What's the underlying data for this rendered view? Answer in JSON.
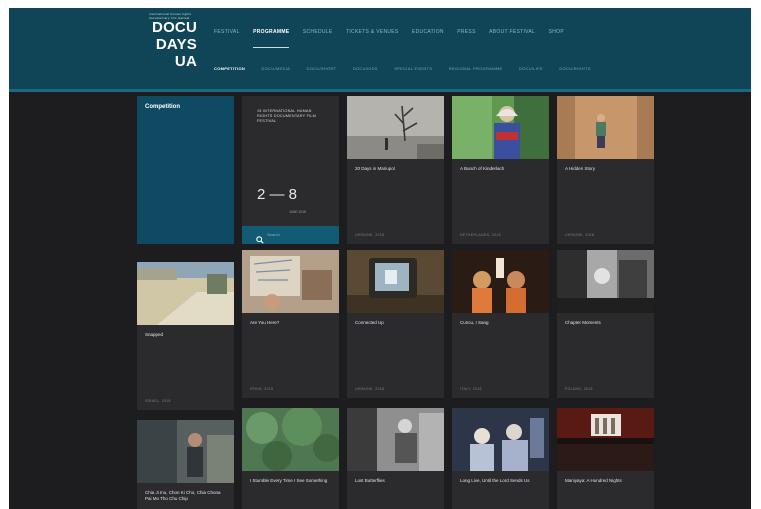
{
  "logo": {
    "tagline": "international human rights documentary film festival",
    "lines": [
      "DOCU",
      "DAYS",
      "UA"
    ]
  },
  "main_nav": [
    "Festival",
    "Programme",
    "Schedule",
    "Tickets & Venues",
    "Education",
    "Press",
    "About festival",
    "Shop"
  ],
  "main_nav_active": 1,
  "sub_nav": [
    "Competition",
    "DOCU/MEDIA",
    "DOCU/SHORT",
    "DOCU/KIDS",
    "SPECIAL EVENTS",
    "REGIONAL PROGRAMME",
    "DOCU/LIFE",
    "DOCU/RIGHTS"
  ],
  "sub_nav_active": 0,
  "competition": {
    "heading": "Competition"
  },
  "festival": {
    "text": "15 International Human Rights Documentary Film Festival",
    "dates": "2 — 8",
    "dates_sub": "June 2018",
    "search_placeholder": "Search"
  },
  "films": [
    {
      "title": "20 Days in Mariupol",
      "meta": "Ukraine, 2018"
    },
    {
      "title": "A Bunch of Kinderlach",
      "meta": "Netherlands, 2018"
    },
    {
      "title": "A Hidden Story",
      "meta": "Ukraine, 2018"
    },
    {
      "title": "Snapped",
      "meta": "Israel, 2018"
    },
    {
      "title": "Are You Here?",
      "meta": "Spain, 2018"
    },
    {
      "title": "Connected Up",
      "meta": "Ukraine, 2018"
    },
    {
      "title": "Cuncu, I Sang",
      "meta": "Italy, 2018"
    },
    {
      "title": "Chapter Moments",
      "meta": "Poland, 2018"
    },
    {
      "title": "Chia Ji Inu, Chon Ki Cho, Chia Chona Pai Mo Tho Chu Chip",
      "meta": ""
    },
    {
      "title": "I Stumble Every Time I See Something",
      "meta": ""
    },
    {
      "title": "Lost Butterflies",
      "meta": ""
    },
    {
      "title": "Long Live, Until the Lord Sends Us",
      "meta": ""
    },
    {
      "title": "Maniyaya: A Hundred Nights",
      "meta": ""
    }
  ]
}
